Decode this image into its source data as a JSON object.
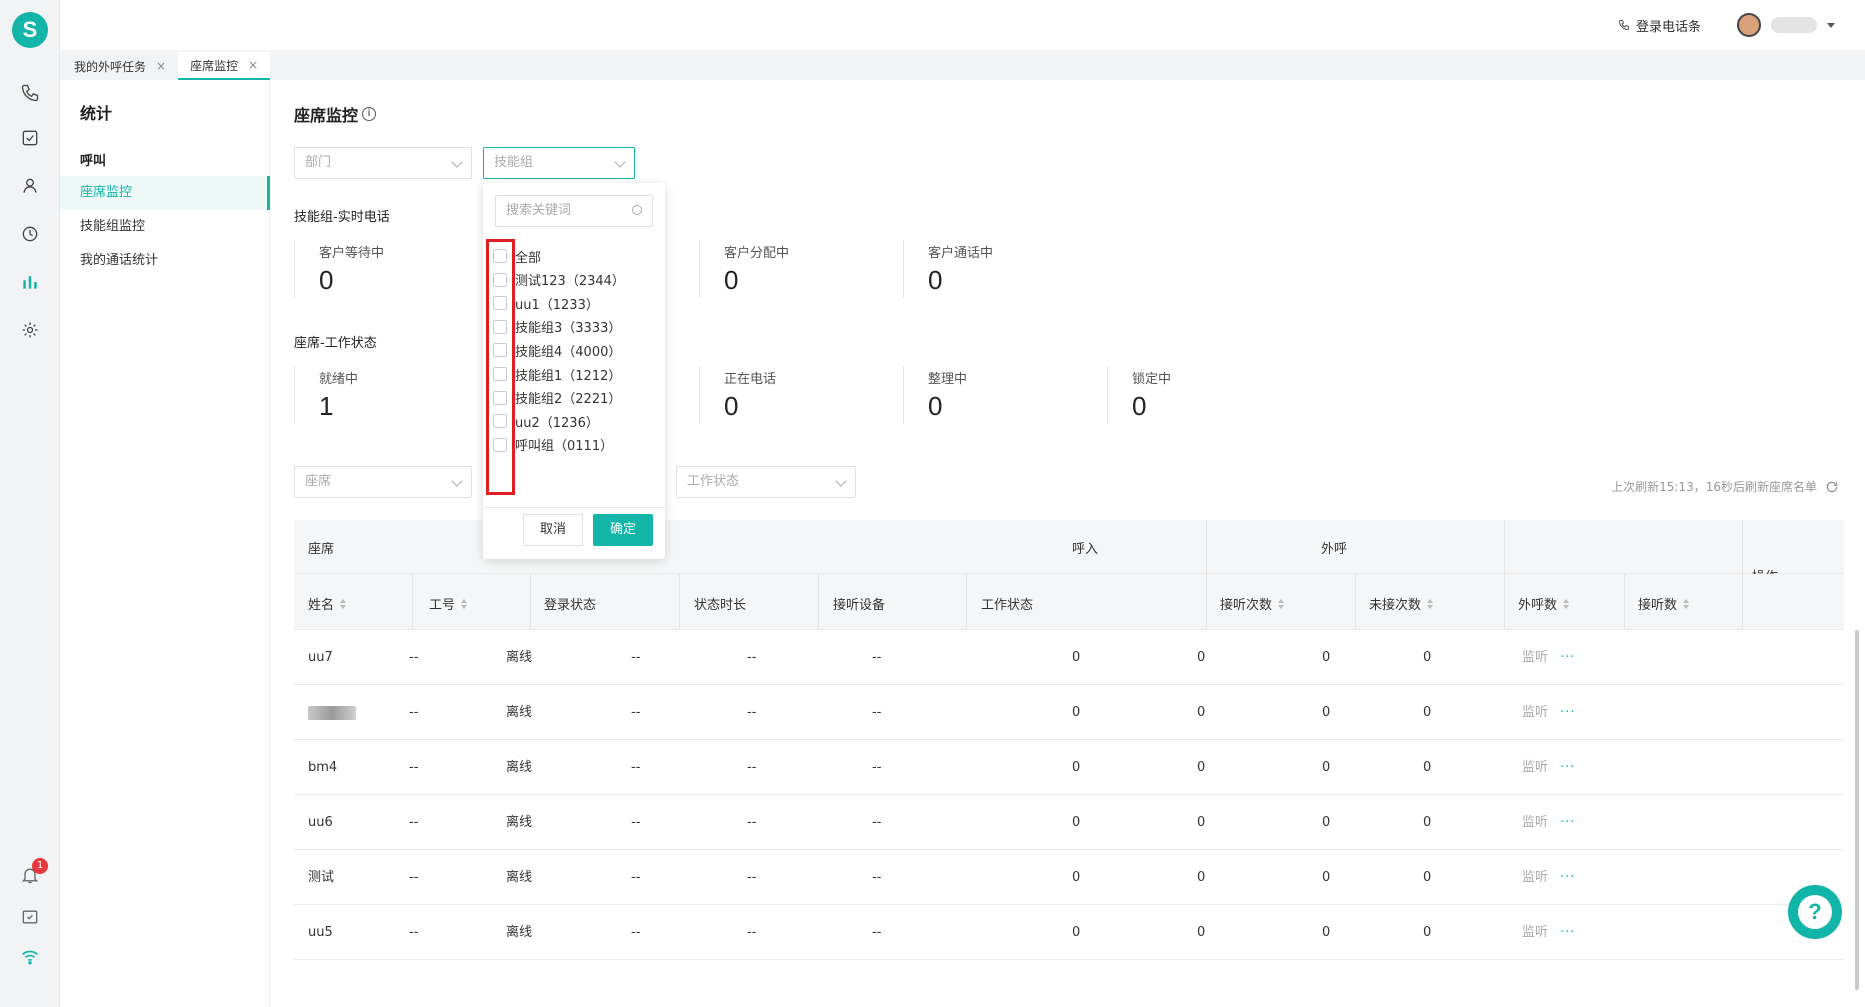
{
  "rail": {
    "logo": "S",
    "badge_count": "1"
  },
  "topbar": {
    "phone_label": "登录电话条"
  },
  "tabs": [
    {
      "label": "我的外呼任务",
      "close": "×"
    },
    {
      "label": "座席监控",
      "close": "×"
    }
  ],
  "subnav": {
    "title": "统计",
    "group": "呼叫",
    "items": [
      "座席监控",
      "技能组监控",
      "我的通话统计"
    ]
  },
  "page": {
    "title": "座席监控",
    "info_icon": "i",
    "filter_department_placeholder": "部门",
    "filter_skillgroup_placeholder": "技能组",
    "section_calls": "技能组-实时电话",
    "section_status": "座席-工作状态",
    "filter_agent_placeholder": "座席",
    "filter_workstatus_placeholder": "工作状态",
    "refresh_text": "上次刷新15:13，16秒后刷新座席名单"
  },
  "stats_calls": [
    {
      "label": "客户等待中",
      "value": "0"
    },
    {
      "label": "客户分配中",
      "value": "0"
    },
    {
      "label": "客户通话中",
      "value": "0"
    }
  ],
  "stats_status": [
    {
      "label": "就绪中",
      "value": "1"
    },
    {
      "label": "正在电话",
      "value": "0"
    },
    {
      "label": "整理中",
      "value": "0"
    },
    {
      "label": "锁定中",
      "value": "0"
    }
  ],
  "table": {
    "group_agent": "座席",
    "group_inbound": "呼入",
    "group_outbound": "外呼",
    "col_action": "操作",
    "columns": [
      "姓名",
      "工号",
      "登录状态",
      "状态时长",
      "接听设备",
      "工作状态",
      "接听次数",
      "未接次数",
      "外呼数",
      "接听数"
    ],
    "action_link": "监听",
    "action_more": "···",
    "rows": [
      {
        "name": "uu7",
        "id": "--",
        "login": "离线",
        "duration": "--",
        "device": "--",
        "work": "--",
        "answered": "0",
        "missed": "0",
        "outbound": "0",
        "out_answered": "0"
      },
      {
        "name": "",
        "id": "--",
        "login": "离线",
        "duration": "--",
        "device": "--",
        "work": "--",
        "answered": "0",
        "missed": "0",
        "outbound": "0",
        "out_answered": "0"
      },
      {
        "name": "bm4",
        "id": "--",
        "login": "离线",
        "duration": "--",
        "device": "--",
        "work": "--",
        "answered": "0",
        "missed": "0",
        "outbound": "0",
        "out_answered": "0"
      },
      {
        "name": "uu6",
        "id": "--",
        "login": "离线",
        "duration": "--",
        "device": "--",
        "work": "--",
        "answered": "0",
        "missed": "0",
        "outbound": "0",
        "out_answered": "0"
      },
      {
        "name": "测试",
        "id": "--",
        "login": "离线",
        "duration": "--",
        "device": "--",
        "work": "--",
        "answered": "0",
        "missed": "0",
        "outbound": "0",
        "out_answered": "0"
      },
      {
        "name": "uu5",
        "id": "--",
        "login": "离线",
        "duration": "--",
        "device": "--",
        "work": "--",
        "answered": "0",
        "missed": "0",
        "outbound": "0",
        "out_answered": "0"
      }
    ]
  },
  "dropdown": {
    "search_placeholder": "搜索关键词",
    "options": [
      "全部",
      "测试123（2344）",
      "uu1（1233）",
      "技能组3（3333）",
      "技能组4（4000）",
      "技能组1（1212）",
      "技能组2（2221）",
      "uu2（1236）",
      "呼叫组（0111）"
    ],
    "cancel": "取消",
    "confirm": "确定"
  },
  "help": {
    "label": "?"
  },
  "colors": {
    "accent": "#13b5a9",
    "highlight": "#e02020",
    "badge": "#e8383d"
  }
}
